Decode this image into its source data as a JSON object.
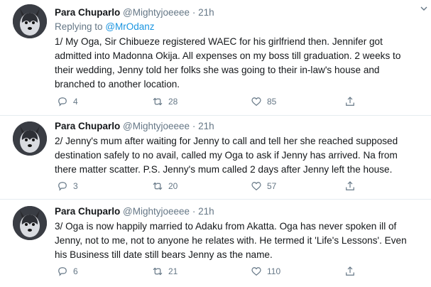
{
  "tweets": [
    {
      "name": "Para Chuparlo",
      "handle": "@Mightyjoeeee",
      "separator": "·",
      "time": "21h",
      "reply_prefix": "Replying to",
      "reply_to": "@MrOdanz",
      "text": "1/ My Oga, Sir Chibueze registered WAEC for his girlfriend then. Jennifer got admitted into Madonna Okija. All expenses on my boss till graduation. 2 weeks to their wedding, Jenny told her folks she was going to their in-law's house and branched to another location.",
      "replies": "4",
      "retweets": "28",
      "likes": "85"
    },
    {
      "name": "Para Chuparlo",
      "handle": "@Mightyjoeeee",
      "separator": "·",
      "time": "21h",
      "text": "2/ Jenny's mum after waiting for Jenny to call and tell her she reached supposed destination safely to no avail, called my Oga to ask if Jenny has arrived. Na from there matter scatter. P.S. Jenny's mum called 2 days after Jenny left the house.",
      "replies": "3",
      "retweets": "20",
      "likes": "57"
    },
    {
      "name": "Para Chuparlo",
      "handle": "@Mightyjoeeee",
      "separator": "·",
      "time": "21h",
      "text": "3/ Oga is now happily married to Adaku from Akatta. Oga has never spoken ill of Jenny, not to me, not to anyone he relates with. He termed it 'Life's Lessons'. Even his Business till date still bears Jenny as the name.",
      "replies": "6",
      "retweets": "21",
      "likes": "110"
    }
  ],
  "icons": {
    "caret": "chevron-down-icon",
    "reply": "reply-icon",
    "retweet": "retweet-icon",
    "like": "heart-icon",
    "share": "share-icon"
  },
  "colors": {
    "name": "#14171a",
    "secondary": "#657786",
    "link": "#1b95e0",
    "divider": "#e6ecf0"
  }
}
